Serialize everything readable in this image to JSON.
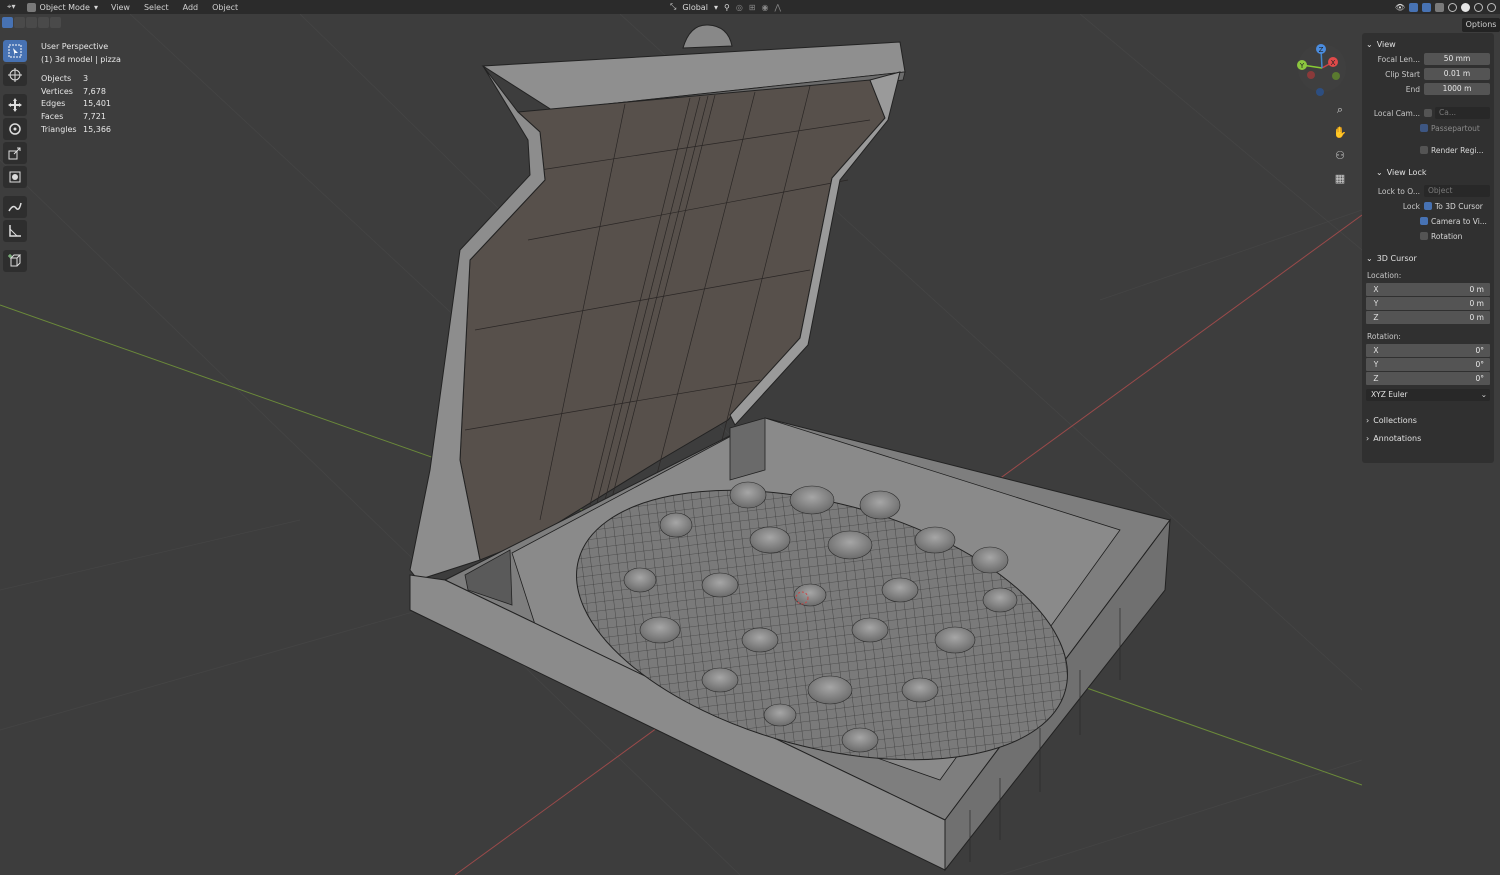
{
  "header": {
    "mode": "Object Mode",
    "menus": [
      "View",
      "Select",
      "Add",
      "Object"
    ],
    "transform_orientation": "Global",
    "options_label": "Options"
  },
  "viewport": {
    "perspective": "User Perspective",
    "object_path": "(1) 3d model | pizza",
    "stats": [
      {
        "label": "Objects",
        "value": "3"
      },
      {
        "label": "Vertices",
        "value": "7,678"
      },
      {
        "label": "Edges",
        "value": "15,401"
      },
      {
        "label": "Faces",
        "value": "7,721"
      },
      {
        "label": "Triangles",
        "value": "15,366"
      }
    ],
    "gizmo_axes": [
      "X",
      "Y",
      "Z"
    ]
  },
  "sidebar": {
    "view": {
      "title": "View",
      "focal_label": "Focal Len...",
      "focal_value": "50 mm",
      "clip_start_label": "Clip Start",
      "clip_start_value": "0.01 m",
      "end_label": "End",
      "end_value": "1000 m",
      "local_camera_label": "Local Cam...",
      "local_camera_value": "Ca...",
      "passepartout": "Passepartout",
      "render_region": "Render Regi..."
    },
    "view_lock": {
      "title": "View Lock",
      "lock_to_label": "Lock to O...",
      "lock_to_placeholder": "Object",
      "lock_label": "Lock",
      "to_3d_cursor": "To 3D Cursor",
      "camera_to_view": "Camera to Vi...",
      "rotation": "Rotation"
    },
    "cursor": {
      "title": "3D Cursor",
      "location_label": "Location:",
      "location": [
        {
          "axis": "X",
          "value": "0 m"
        },
        {
          "axis": "Y",
          "value": "0 m"
        },
        {
          "axis": "Z",
          "value": "0 m"
        }
      ],
      "rotation_label": "Rotation:",
      "rotation": [
        {
          "axis": "X",
          "value": "0°"
        },
        {
          "axis": "Y",
          "value": "0°"
        },
        {
          "axis": "Z",
          "value": "0°"
        }
      ],
      "rotation_mode": "XYZ Euler"
    },
    "collections": "Collections",
    "annotations": "Annotations"
  },
  "colors": {
    "background": "#3d3d3d",
    "accent": "#4772b3",
    "axis_x": "#9a4a4a",
    "axis_y": "#6b8a3a"
  }
}
